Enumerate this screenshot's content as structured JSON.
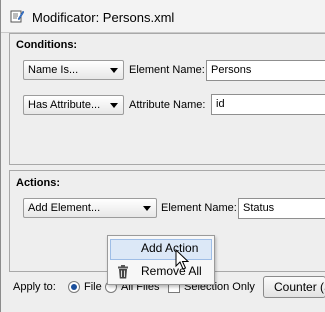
{
  "window": {
    "title": "Modificator: Persons.xml"
  },
  "conditions": {
    "title": "Conditions:",
    "rows": [
      {
        "combo": "Name Is...",
        "label": "Element Name:",
        "value": "Persons"
      },
      {
        "combo": "Has Attribute...",
        "label": "Attribute Name:",
        "value": "id"
      }
    ]
  },
  "actions": {
    "title": "Actions:",
    "rows": [
      {
        "combo": "Add Element...",
        "label": "Element Name:",
        "value": "Status"
      }
    ]
  },
  "context_menu": {
    "items": [
      {
        "label": "Add Action",
        "icon": "none",
        "highlighted": true
      },
      {
        "label": "Remove All",
        "icon": "trash-icon",
        "highlighted": false
      }
    ]
  },
  "bottom": {
    "apply_to_label": "Apply to:",
    "radio_file": "File",
    "radio_all_files": "All Files",
    "selection_only": "Selection Only",
    "counter_button": "Counter (S"
  }
}
